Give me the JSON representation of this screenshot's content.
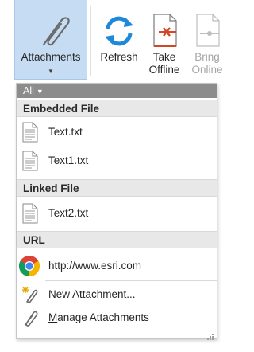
{
  "ribbon": {
    "attachments": {
      "label": "Attachments",
      "icon": "paperclip-icon"
    },
    "refresh": {
      "label": "Refresh",
      "icon": "refresh-icon"
    },
    "take_offline": {
      "line1": "Take",
      "line2": "Offline",
      "icon": "take-offline-icon"
    },
    "bring_online": {
      "line1": "Bring",
      "line2": "Online",
      "icon": "bring-online-icon",
      "disabled": true
    }
  },
  "filter": {
    "label": "All"
  },
  "sections": {
    "embedded": {
      "title": "Embedded File"
    },
    "linked": {
      "title": "Linked File"
    },
    "url": {
      "title": "URL"
    }
  },
  "items": {
    "embedded": [
      "Text.txt",
      "Text1.txt"
    ],
    "linked": [
      "Text2.txt"
    ],
    "url": [
      "http://www.esri.com"
    ]
  },
  "commands": {
    "new_attachment": {
      "mnemonic": "N",
      "rest": "ew Attachment..."
    },
    "manage_attachments": {
      "mnemonic": "M",
      "rest": "anage Attachments"
    }
  },
  "colors": {
    "ribbon_selected": "#c6dcf2",
    "refresh_blue": "#1e88d9",
    "offline_red": "#d24726",
    "filter_bar": "#8c8c8c",
    "section_header": "#e8e8e8"
  }
}
